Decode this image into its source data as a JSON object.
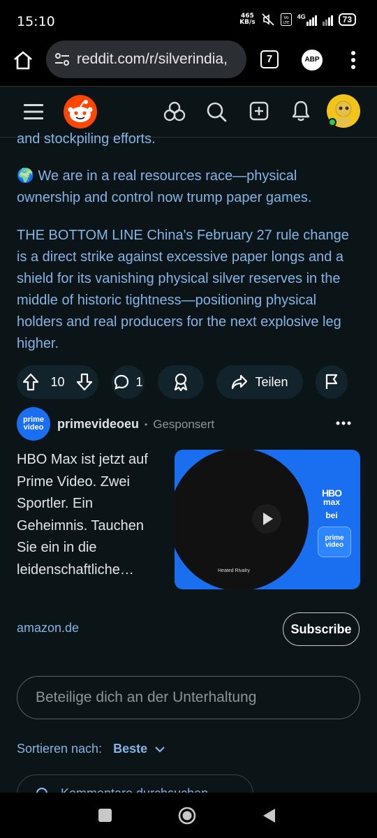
{
  "status_bar": {
    "time": "15:10",
    "net_speed_value": "465",
    "net_speed_unit": "KB/s",
    "network": "4G",
    "battery": "73"
  },
  "browser": {
    "url": "reddit.com/r/silverindia,",
    "tab_count": "7",
    "adblock_label": "ABP"
  },
  "post": {
    "partial_line": "and stockpiling efforts.",
    "para1": "🌍 We are in a real resources race—physical ownership and control now trump paper games.",
    "para2": "THE BOTTOM LINE China's February 27 rule change is a direct strike against excessive paper longs and a shield for its vanishing physical silver reserves in the middle of historic tightness—positioning physical holders and real producers for the next explosive leg higher.",
    "vote_count": "10",
    "comment_count": "1",
    "share_label": "Teilen"
  },
  "ad": {
    "avatar_text": "prime video",
    "advertiser": "primevideoeu",
    "separator": "•",
    "sponsored": "Gesponsert",
    "text": "HBO Max ist jetzt auf Prime Video. Zwei Sportler. Ein Geheimnis. Tauchen Sie ein in die leidenschaftliche…",
    "thumb_hbo": "HBO",
    "thumb_max": "max",
    "thumb_bei": "bei",
    "thumb_prime": "prime video",
    "thumb_show": "Heated Rivalry",
    "domain": "amazon.de",
    "subscribe_label": "Subscribe"
  },
  "comments": {
    "placeholder": "Beteilige dich an der Unterhaltung",
    "sort_label": "Sortieren nach:",
    "sort_value": "Beste",
    "search_partial": "Kommentare durchsuchen"
  },
  "colors": {
    "link_blue": "#86b4e6",
    "reddit_orange": "#ff4500",
    "prime_blue": "#1a6ef0",
    "background": "#0b1416"
  }
}
